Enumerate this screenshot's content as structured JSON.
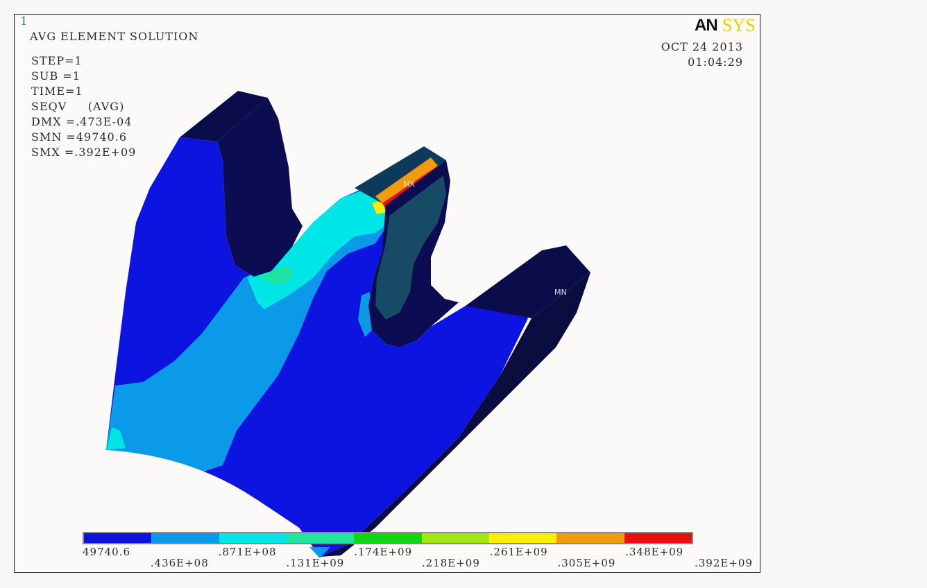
{
  "window_number": "1",
  "plot_title": "AVG ELEMENT SOLUTION",
  "info_lines": [
    "STEP=1",
    "SUB =1",
    "TIME=1",
    "SEQV     (AVG)",
    "DMX =.473E-04",
    "SMN =49740.6",
    "SMX =.392E+09"
  ],
  "logo": {
    "part1": "AN",
    "part2": "SYS"
  },
  "date": "OCT 24 2013",
  "time": "01:04:29",
  "markers": {
    "max": "MX",
    "min": "MN"
  },
  "legend": {
    "colors": [
      "#0d14e0",
      "#0a9ae8",
      "#00e6e6",
      "#1ee6a0",
      "#12d512",
      "#a2e614",
      "#ffee00",
      "#f09a10",
      "#e61010"
    ],
    "labels_top": [
      "49740.6",
      ".871E+08",
      ".174E+09",
      ".261E+09",
      ".348E+09"
    ],
    "labels_bottom": [
      ".436E+08",
      ".131E+09",
      ".218E+09",
      ".305E+09",
      ".392E+09"
    ]
  }
}
